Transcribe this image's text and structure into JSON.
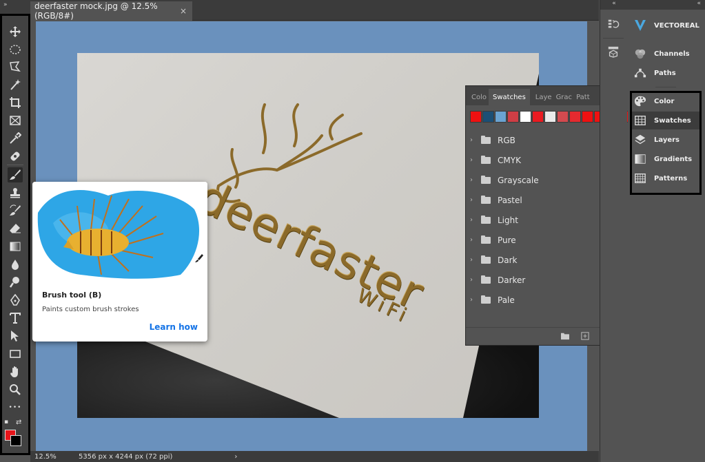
{
  "document": {
    "tab_title": "deerfaster mock.jpg @ 12.5% (RGB/8#)",
    "close_symbol": "×",
    "logo_main_text": "deerfaster",
    "logo_sub_text": "WiFi"
  },
  "status": {
    "zoom": "12.5%",
    "doc_size": "5356 px x 4244 px (72 ppi)",
    "arrow": "›"
  },
  "tooltip": {
    "title": "Brush tool (B)",
    "description": "Paints custom brush strokes",
    "link": "Learn how"
  },
  "toolbar": {
    "collapse_symbol": "»",
    "more_tools_symbol": "•••",
    "colors": {
      "foreground": "#e8141a",
      "background": "#000000"
    },
    "tools": [
      {
        "name": "move-tool",
        "icon": "move-icon"
      },
      {
        "name": "marquee-tool",
        "icon": "ellipse-marquee-icon"
      },
      {
        "name": "lasso-tool",
        "icon": "polygonal-lasso-icon"
      },
      {
        "name": "magic-wand-tool",
        "icon": "magic-wand-icon"
      },
      {
        "name": "crop-tool",
        "icon": "crop-icon"
      },
      {
        "name": "frame-tool",
        "icon": "frame-icon"
      },
      {
        "name": "eyedropper-tool",
        "icon": "eyedropper-icon"
      },
      {
        "name": "healing-brush-tool",
        "icon": "bandage-icon"
      },
      {
        "name": "brush-tool",
        "icon": "brush-icon"
      },
      {
        "name": "clone-stamp-tool",
        "icon": "stamp-icon"
      },
      {
        "name": "history-brush-tool",
        "icon": "history-brush-icon"
      },
      {
        "name": "eraser-tool",
        "icon": "eraser-icon"
      },
      {
        "name": "gradient-tool",
        "icon": "gradient-icon"
      },
      {
        "name": "blur-tool",
        "icon": "drop-icon"
      },
      {
        "name": "dodge-tool",
        "icon": "dodge-icon"
      },
      {
        "name": "pen-tool",
        "icon": "pen-icon"
      },
      {
        "name": "type-tool",
        "icon": "type-icon"
      },
      {
        "name": "path-selection-tool",
        "icon": "arrow-icon"
      },
      {
        "name": "rectangle-tool",
        "icon": "rectangle-icon"
      },
      {
        "name": "hand-tool",
        "icon": "hand-icon"
      },
      {
        "name": "zoom-tool",
        "icon": "magnifier-icon"
      }
    ]
  },
  "swatches_panel": {
    "tabs": [
      "Colo",
      "Swatches",
      "Laye",
      "Grac",
      "Patt"
    ],
    "active_tab": "Swatches",
    "more_symbol": "»",
    "menu_symbol": "≡",
    "recent_colors": [
      "#ee1111",
      "#1c4f75",
      "#6aa3d1",
      "#cf3e45",
      "#ffffff",
      "#e91b21",
      "#eaeaea",
      "#d34a4f",
      "#e52a2f",
      "#ee1111",
      "#ee1111",
      "#ee1111",
      "#ee1111"
    ],
    "groups": [
      "RGB",
      "CMYK",
      "Grayscale",
      "Pastel",
      "Light",
      "Pure",
      "Dark",
      "Darker",
      "Pale"
    ],
    "chevron_symbol": "›",
    "bottom_buttons": {
      "folder": "▭",
      "new": "⊞",
      "delete": "🗑"
    }
  },
  "dock_narrow": {
    "collapse_symbol": "«",
    "buttons": [
      {
        "name": "history-button",
        "icon": "history-icon",
        "symbol": "↺"
      },
      {
        "name": "3d-button",
        "icon": "cube-icon",
        "symbol": "⬡"
      }
    ]
  },
  "dock_wide": {
    "collapse_symbol": "«",
    "items": [
      {
        "label": "VECTOREAL",
        "icon": "vectoreal-logo-icon",
        "symbol": "V"
      },
      {
        "label": "Channels",
        "icon": "channels-icon",
        "symbol": "◍"
      },
      {
        "label": "Paths",
        "icon": "paths-icon",
        "symbol": "⌗"
      },
      {
        "label": "Color",
        "icon": "palette-icon",
        "symbol": "🎨"
      },
      {
        "label": "Swatches",
        "icon": "grid-icon",
        "symbol": "▦"
      },
      {
        "label": "Layers",
        "icon": "layers-icon",
        "symbol": "◈"
      },
      {
        "label": "Gradients",
        "icon": "gradient-square-icon",
        "symbol": "▣"
      },
      {
        "label": "Patterns",
        "icon": "patterns-icon",
        "symbol": "▩"
      }
    ],
    "active_item": "Swatches"
  }
}
